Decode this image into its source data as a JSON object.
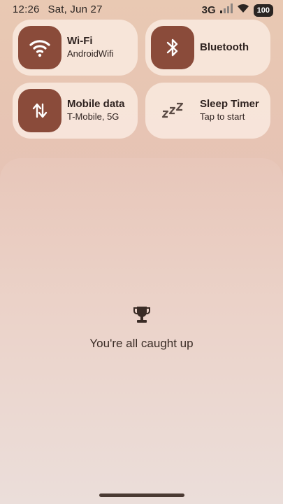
{
  "status_bar": {
    "time": "12:26",
    "date": "Sat, Jun 27",
    "network_type": "3G",
    "battery": "100"
  },
  "tiles": [
    {
      "title": "Wi-Fi",
      "subtitle": "AndroidWifi",
      "icon": "wifi-icon",
      "active": true
    },
    {
      "title": "Bluetooth",
      "subtitle": "",
      "icon": "bluetooth-icon",
      "active": true
    },
    {
      "title": "Mobile data",
      "subtitle": "T-Mobile, 5G",
      "icon": "mobile-data-icon",
      "active": true
    },
    {
      "title": "Sleep Timer",
      "subtitle": "Tap to start",
      "icon": "sleep-icon",
      "active": false
    }
  ],
  "notifications": {
    "empty_message": "You're all caught up",
    "empty_icon": "trophy-icon"
  },
  "colors": {
    "accent": "#8a4b3a",
    "tile_bg": "#faece2"
  }
}
